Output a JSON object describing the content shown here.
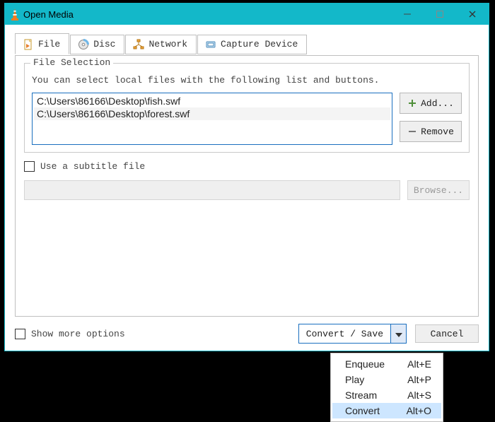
{
  "window": {
    "title": "Open Media"
  },
  "tabs": [
    {
      "label": "File"
    },
    {
      "label": "Disc"
    },
    {
      "label": "Network"
    },
    {
      "label": "Capture Device"
    }
  ],
  "file_selection": {
    "legend": "File Selection",
    "hint": "You can select local files with the following list and buttons.",
    "files": [
      "C:\\Users\\86166\\Desktop\\fish.swf",
      "C:\\Users\\86166\\Desktop\\forest.swf"
    ],
    "add_label": "Add...",
    "remove_label": "Remove"
  },
  "subtitle": {
    "checkbox_label": "Use a subtitle file",
    "browse_label": "Browse..."
  },
  "more_options_label": "Show more options",
  "footer": {
    "convert_label": "Convert / Save",
    "cancel_label": "Cancel"
  },
  "dropdown": [
    {
      "label": "Enqueue",
      "shortcut": "Alt+E"
    },
    {
      "label": "Play",
      "shortcut": "Alt+P"
    },
    {
      "label": "Stream",
      "shortcut": "Alt+S"
    },
    {
      "label": "Convert",
      "shortcut": "Alt+O"
    }
  ]
}
